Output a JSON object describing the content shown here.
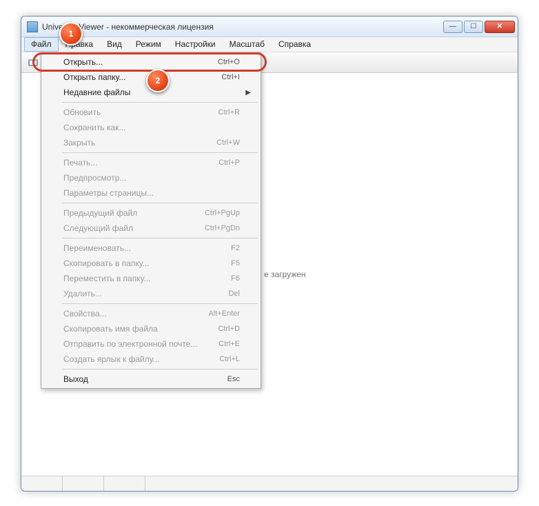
{
  "window": {
    "title": "Universal Viewer - некоммерческая лицензия"
  },
  "menubar": {
    "items": [
      "Файл",
      "Правка",
      "Вид",
      "Режим",
      "Настройки",
      "Масштаб",
      "Справка"
    ]
  },
  "content": {
    "placeholder_suffix": "е загружен"
  },
  "dropdown": {
    "items": [
      {
        "label": "Открыть...",
        "shortcut": "Ctrl+O",
        "enabled": true
      },
      {
        "label": "Открыть папку...",
        "shortcut": "Ctrl+I",
        "enabled": true
      },
      {
        "label": "Недавние файлы",
        "submenu": true,
        "enabled": true
      },
      {
        "sep": true
      },
      {
        "label": "Обновить",
        "shortcut": "Ctrl+R",
        "enabled": false
      },
      {
        "label": "Сохранить как...",
        "enabled": false
      },
      {
        "label": "Закрыть",
        "shortcut": "Ctrl+W",
        "enabled": false
      },
      {
        "sep": true
      },
      {
        "label": "Печать...",
        "shortcut": "Ctrl+P",
        "enabled": false
      },
      {
        "label": "Предпросмотр...",
        "enabled": false
      },
      {
        "label": "Параметры страницы...",
        "enabled": false
      },
      {
        "sep": true
      },
      {
        "label": "Предыдущий файл",
        "shortcut": "Ctrl+PgUp",
        "enabled": false
      },
      {
        "label": "Следующий файл",
        "shortcut": "Ctrl+PgDn",
        "enabled": false
      },
      {
        "sep": true
      },
      {
        "label": "Переименовать...",
        "shortcut": "F2",
        "enabled": false
      },
      {
        "label": "Скопировать в папку...",
        "shortcut": "F5",
        "enabled": false
      },
      {
        "label": "Переместить в папку...",
        "shortcut": "F6",
        "enabled": false
      },
      {
        "label": "Удалить...",
        "shortcut": "Del",
        "enabled": false
      },
      {
        "sep": true
      },
      {
        "label": "Свойства...",
        "shortcut": "Alt+Enter",
        "enabled": false
      },
      {
        "label": "Скопировать имя файла",
        "shortcut": "Ctrl+D",
        "enabled": false
      },
      {
        "label": "Отправить по электронной почте...",
        "shortcut": "Ctrl+E",
        "enabled": false
      },
      {
        "label": "Создать ярлык к файлу...",
        "shortcut": "Ctrl+L",
        "enabled": false
      },
      {
        "sep": true
      },
      {
        "label": "Выход",
        "shortcut": "Esc",
        "enabled": true
      }
    ]
  },
  "badges": {
    "one": "1",
    "two": "2"
  }
}
